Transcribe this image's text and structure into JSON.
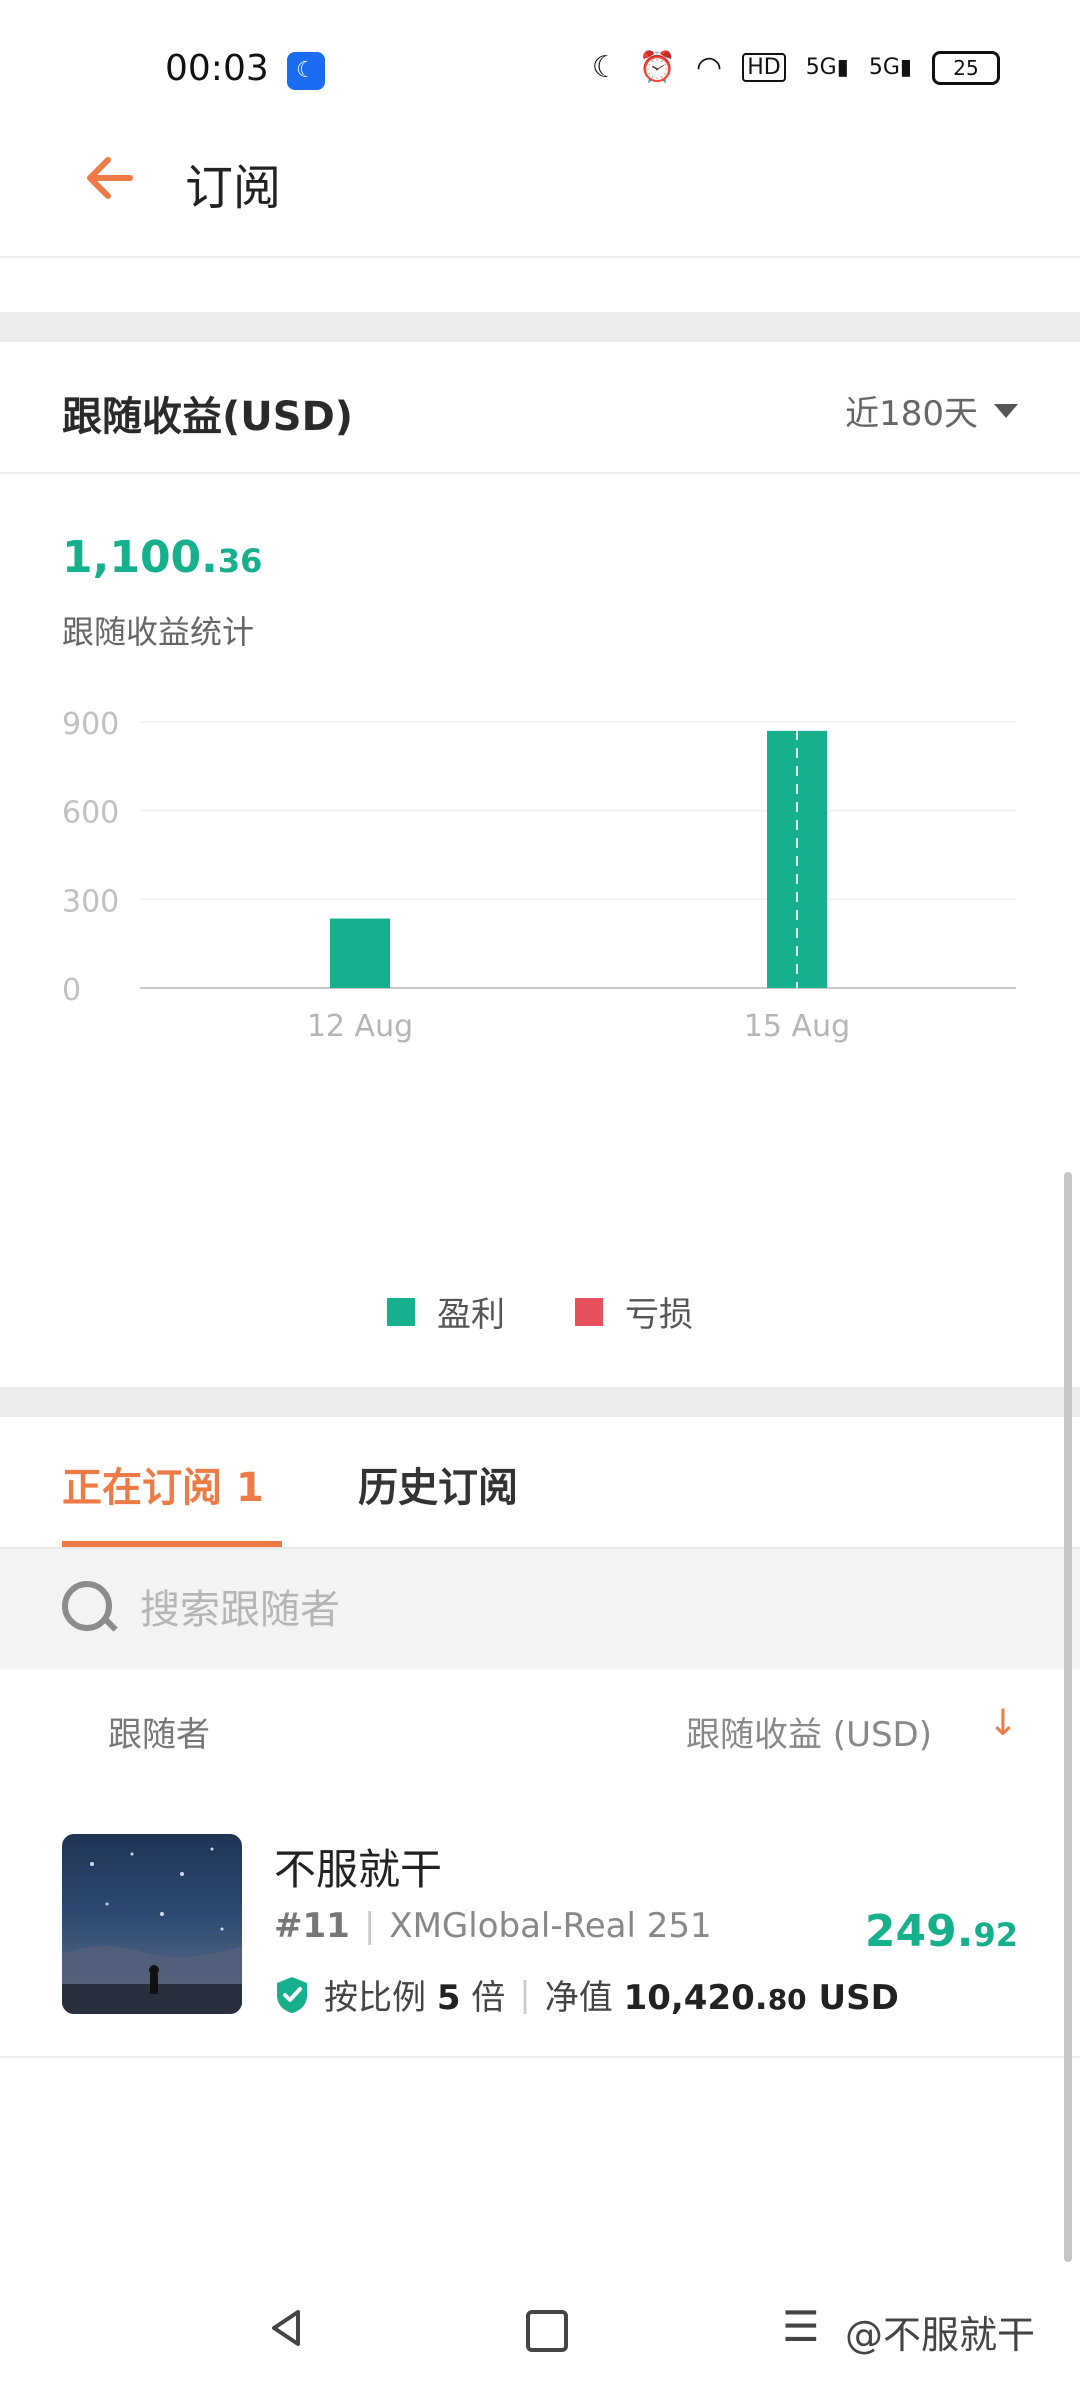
{
  "status_bar": {
    "time": "00:03",
    "battery": "25",
    "network1": "5G",
    "network2": "5G",
    "hd": "HD"
  },
  "header": {
    "title": "订阅"
  },
  "earnings_card": {
    "title": "跟随收益(USD)",
    "range": "近180天",
    "total_int": "1,100.",
    "total_dec": "36",
    "total_label": "跟随收益统计"
  },
  "chart_data": {
    "type": "bar",
    "categories": [
      "12 Aug",
      "15 Aug"
    ],
    "series": [
      {
        "name": "盈利",
        "values": [
          235,
          870
        ],
        "color": "#17b08d"
      },
      {
        "name": "亏损",
        "values": [
          0,
          0
        ],
        "color": "#e5505a"
      }
    ],
    "yticks": [
      "0",
      "300",
      "600",
      "900"
    ],
    "ylim": [
      0,
      900
    ],
    "grid": true,
    "legend": "bottom"
  },
  "tabs": {
    "active": "正在订阅",
    "active_count": "1",
    "inactive": "历史订阅"
  },
  "search": {
    "placeholder": "搜索跟随者"
  },
  "list_header": {
    "follower": "跟随者",
    "profit": "跟随收益 (USD)"
  },
  "followers": [
    {
      "name": "不服就干",
      "rank": "#11",
      "account": "XMGlobal-Real 251",
      "ratio_label": "按比例",
      "ratio_value": "5",
      "ratio_unit": "倍",
      "equity_label": "净值",
      "equity_int": "10,420.",
      "equity_dec": "80",
      "equity_currency": "USD",
      "profit_int": "249.",
      "profit_dec": "92"
    }
  ],
  "watermark": "@不服就干",
  "colors": {
    "accent": "#ee7a45",
    "profit": "#17b08d",
    "loss": "#e5505a"
  }
}
